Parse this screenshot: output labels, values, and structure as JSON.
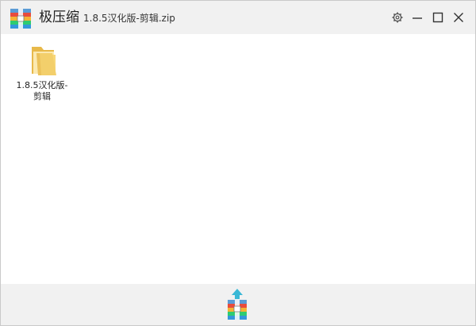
{
  "app": {
    "name": "极压缩",
    "file_name": "1.8.5汉化版-剪辑.zip"
  },
  "window_controls": {
    "settings_icon": "gear-icon",
    "minimize_icon": "minimize-icon",
    "maximize_icon": "maximize-icon",
    "close_icon": "close-icon"
  },
  "files": [
    {
      "name": "1.8.5汉化版-剪辑",
      "type": "folder",
      "icon": "folder-icon"
    }
  ],
  "footer": {
    "action_icon": "compress-icon"
  },
  "colors": {
    "titlebar_bg": "#f1f1f1",
    "content_bg": "#ffffff",
    "folder_yellow": "#f3cf6b"
  }
}
